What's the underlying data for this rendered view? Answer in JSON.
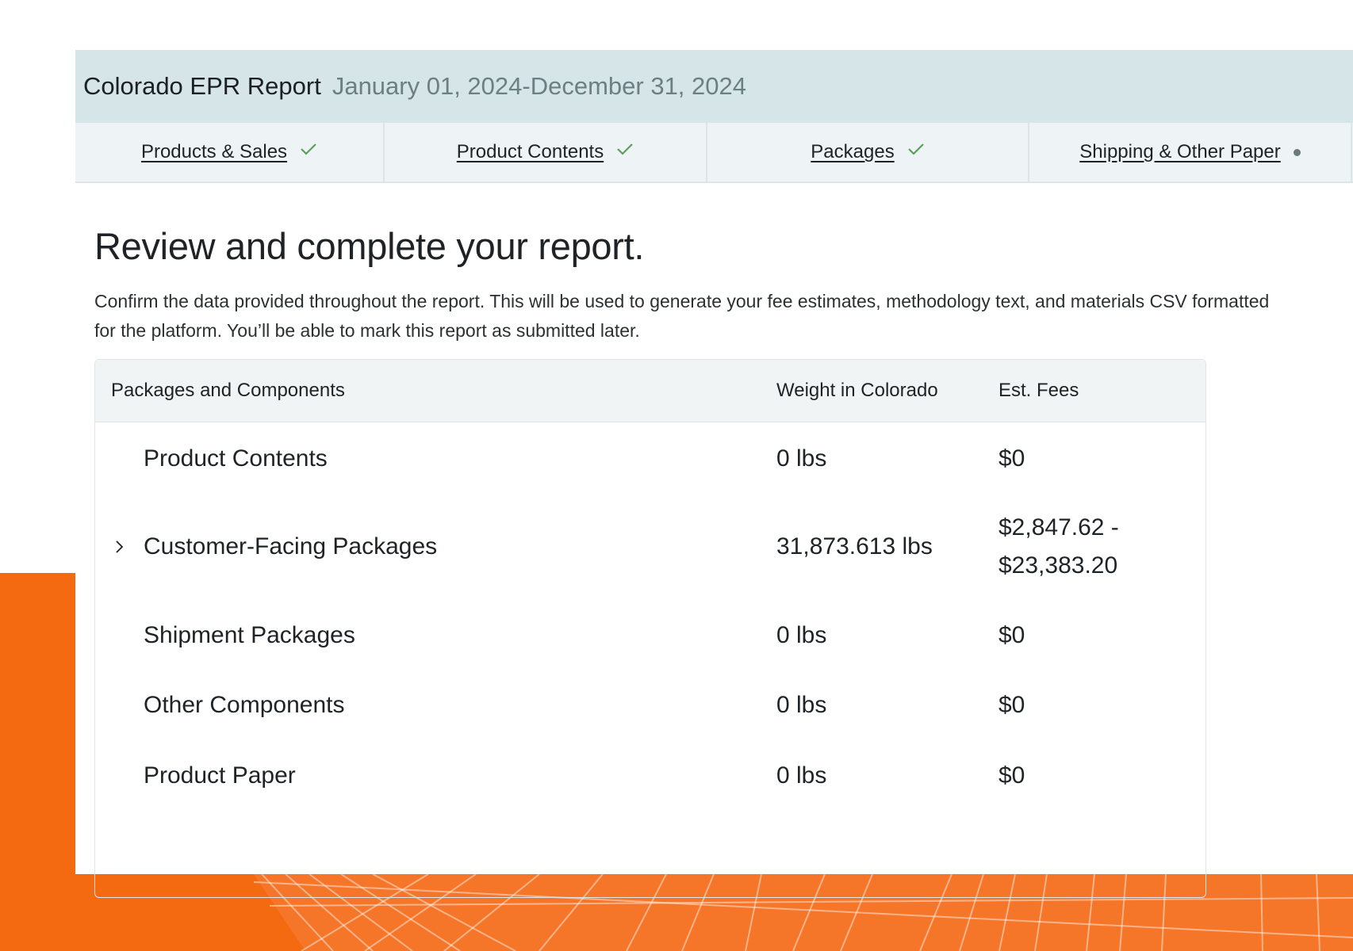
{
  "header": {
    "title": "Colorado EPR Report",
    "date_range": "January 01, 2024-December 31, 2024"
  },
  "tabs": [
    {
      "label": "Products & Sales",
      "status": "complete",
      "status_icon": "check-icon"
    },
    {
      "label": "Product Contents",
      "status": "complete",
      "status_icon": "check-icon"
    },
    {
      "label": "Packages",
      "status": "complete",
      "status_icon": "check-icon"
    },
    {
      "label": "Shipping & Other Paper",
      "status": "in-progress",
      "status_icon": "dot-icon"
    }
  ],
  "main": {
    "heading": "Review and complete your report.",
    "description": "Confirm the data provided throughout the report. This will be used to generate your fee estimates, methodology text, and materials CSV formatted for the platform. You’ll be able to mark this report as submitted later."
  },
  "table": {
    "headers": {
      "components": "Packages and Components",
      "weight": "Weight in Colorado",
      "fees": "Est. Fees"
    },
    "rows": [
      {
        "name": "Product Contents",
        "weight": "0 lbs",
        "fees_line1": "$0",
        "fees_line2": "",
        "expandable": false
      },
      {
        "name": "Customer-Facing Packages",
        "weight": "31,873.613 lbs",
        "fees_line1": "$2,847.62 -",
        "fees_line2": "$23,383.20",
        "expandable": true
      },
      {
        "name": "Shipment Packages",
        "weight": "0 lbs",
        "fees_line1": "$0",
        "fees_line2": "",
        "expandable": false
      },
      {
        "name": "Other Components",
        "weight": "0 lbs",
        "fees_line1": "$0",
        "fees_line2": "",
        "expandable": false
      },
      {
        "name": "Product Paper",
        "weight": "0 lbs",
        "fees_line1": "$0",
        "fees_line2": "",
        "expandable": false
      }
    ]
  },
  "colors": {
    "titlebar_bg": "#d5e5e8",
    "tabbar_bg": "#eef4f5",
    "check_green": "#5aa05a",
    "accent_orange": "#f46a10"
  }
}
